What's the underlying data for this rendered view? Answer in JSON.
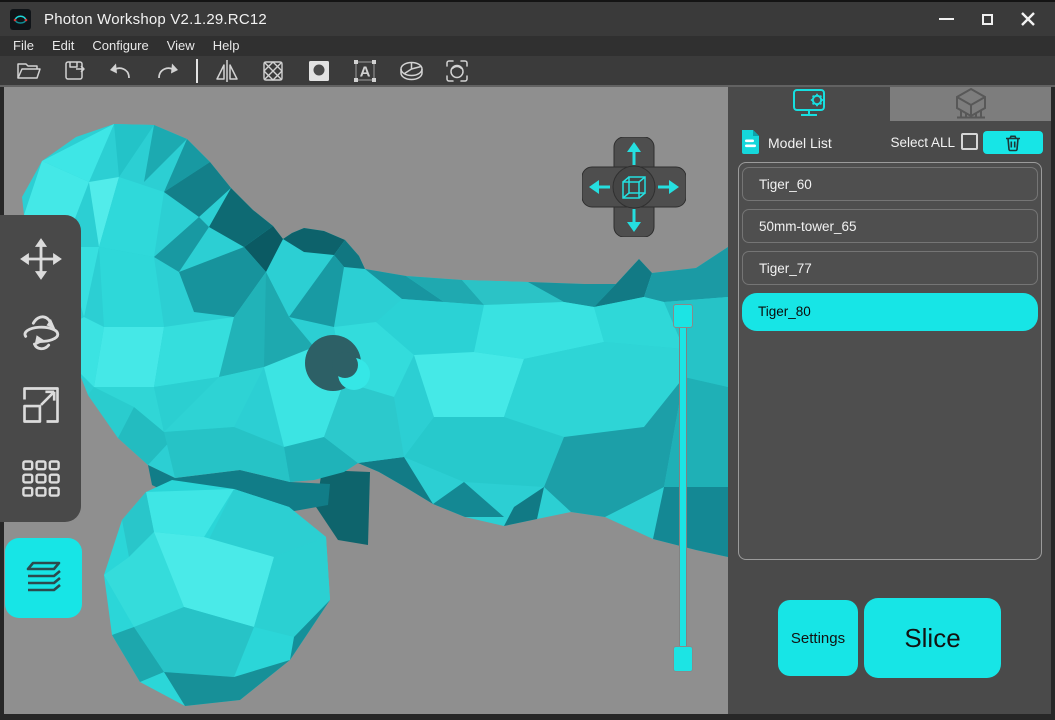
{
  "window": {
    "title": "Photon Workshop V2.1.29.RC12",
    "controls": [
      "minimize",
      "maximize",
      "close"
    ]
  },
  "menu_bar": {
    "items": [
      "File",
      "Edit",
      "Configure",
      "View",
      "Help"
    ]
  },
  "toolbar": {
    "tools": [
      "open-file",
      "save-file",
      "undo",
      "redo",
      "mirror",
      "hollow",
      "punch-hole",
      "text",
      "split",
      "face-detect"
    ]
  },
  "left_toolbar": {
    "tools": [
      "move",
      "rotate",
      "scale",
      "array"
    ],
    "active_tool": "layer-slider"
  },
  "viewport": {
    "model_shown": "Tiger_80",
    "overlays": [
      "view-navigation-pad",
      "layer-slider"
    ]
  },
  "right_panel": {
    "tabs": [
      {
        "name": "model-settings",
        "icon": "monitor-gear-icon",
        "active": true
      },
      {
        "name": "print-preview",
        "icon": "printer-icon",
        "active": false
      }
    ],
    "model_list": {
      "title": "Model List",
      "select_all_label": "Select ALL",
      "select_all_checked": false,
      "items": [
        {
          "name": "Tiger_60",
          "selected": false
        },
        {
          "name": "50mm-tower_65",
          "selected": false
        },
        {
          "name": "Tiger_77",
          "selected": false
        },
        {
          "name": "Tiger_80",
          "selected": true
        }
      ]
    },
    "actions": {
      "settings_label": "Settings",
      "slice_label": "Slice"
    }
  },
  "colors": {
    "accent": "#17e5e6",
    "model_cyan": "#2ccfd3",
    "viewport_bg": "#8f8f8f",
    "panel_bg": "#4a4a4a",
    "chrome_bg": "#3a3a3a",
    "inactive_tab_bg": "#7d7d7d",
    "selected_item_text": "#0b0b0b"
  }
}
